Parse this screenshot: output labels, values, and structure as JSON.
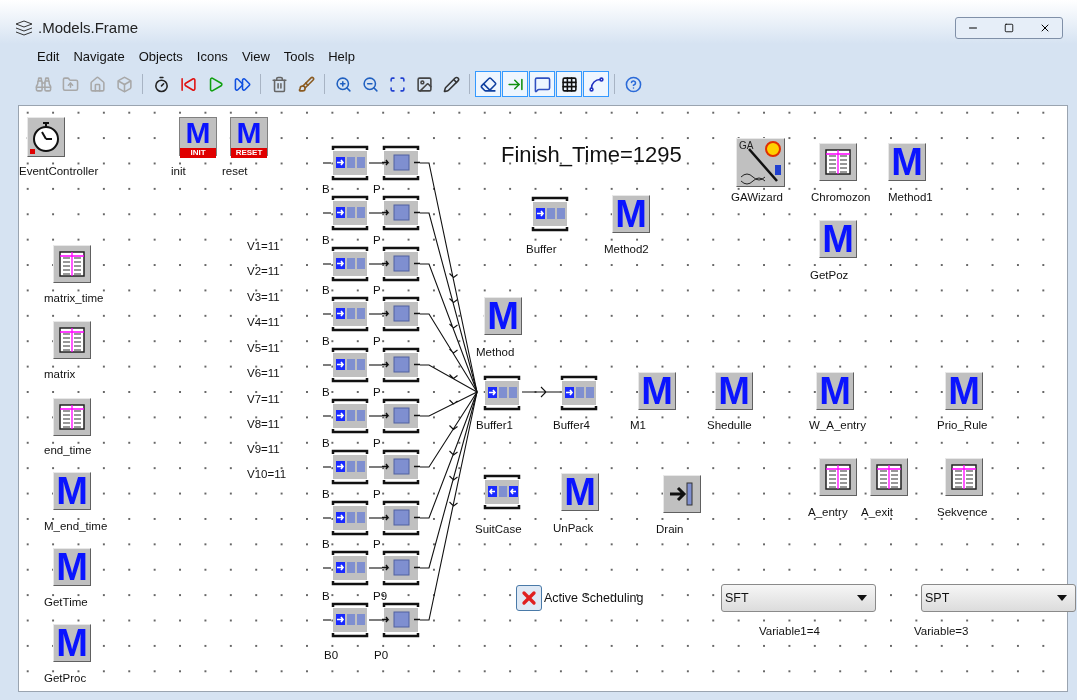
{
  "window": {
    "title": ".Models.Frame"
  },
  "menu": [
    "Edit",
    "Navigate",
    "Objects",
    "Icons",
    "View",
    "Tools",
    "Help"
  ],
  "toolbar": [
    {
      "kind": "binoculars",
      "disabled": true,
      "pressed": false
    },
    {
      "kind": "folder_up",
      "disabled": true,
      "pressed": false
    },
    {
      "kind": "home",
      "disabled": true,
      "pressed": false
    },
    {
      "kind": "three_d",
      "disabled": true,
      "pressed": false
    },
    {
      "kind": "separator"
    },
    {
      "kind": "stopwatch",
      "disabled": false,
      "pressed": false
    },
    {
      "kind": "reset",
      "disabled": false,
      "pressed": false
    },
    {
      "kind": "play",
      "disabled": false,
      "pressed": false
    },
    {
      "kind": "fast_forward",
      "disabled": false,
      "pressed": false
    },
    {
      "kind": "separator"
    },
    {
      "kind": "delete",
      "disabled": false,
      "pressed": false
    },
    {
      "kind": "broom",
      "disabled": false,
      "pressed": false
    },
    {
      "kind": "separator"
    },
    {
      "kind": "zoom_in",
      "disabled": false,
      "pressed": false
    },
    {
      "kind": "zoom_out",
      "disabled": false,
      "pressed": false
    },
    {
      "kind": "fit",
      "disabled": false,
      "pressed": false
    },
    {
      "kind": "picture",
      "disabled": false,
      "pressed": false
    },
    {
      "kind": "pencil",
      "disabled": false,
      "pressed": false
    },
    {
      "kind": "separator"
    },
    {
      "kind": "eraser",
      "disabled": false,
      "pressed": true
    },
    {
      "kind": "connector",
      "disabled": false,
      "pressed": true
    },
    {
      "kind": "comment",
      "disabled": false,
      "pressed": true
    },
    {
      "kind": "grid",
      "disabled": false,
      "pressed": true
    },
    {
      "kind": "curve",
      "disabled": false,
      "pressed": true
    },
    {
      "kind": "separator"
    },
    {
      "kind": "help",
      "disabled": false,
      "pressed": false
    }
  ],
  "canvas": {
    "finish_time": "Finish_Time=1295",
    "objects": [
      {
        "kind": "event_controller",
        "label": "EventController"
      },
      {
        "kind": "init",
        "label": "init",
        "icon_text": "M",
        "badge": "INIT"
      },
      {
        "kind": "reset",
        "label": "reset",
        "icon_text": "M",
        "badge": "RESET"
      },
      {
        "kind": "wizard",
        "label": "GAWizard",
        "icon_text": "GA"
      },
      {
        "kind": "table",
        "label": "Chromozon"
      },
      {
        "kind": "method",
        "label": "Method1",
        "icon_text": "M"
      },
      {
        "kind": "buffer",
        "label": "Buffer"
      },
      {
        "kind": "method",
        "label": "Method2",
        "icon_text": "M"
      },
      {
        "kind": "method",
        "label": "GetPoz",
        "icon_text": "M"
      },
      {
        "kind": "table",
        "label": "matrix_time"
      },
      {
        "kind": "method",
        "label": "Method",
        "icon_text": "M"
      },
      {
        "kind": "table",
        "label": "matrix"
      },
      {
        "kind": "buffer",
        "label": "Buffer1"
      },
      {
        "kind": "buffer",
        "label": "Buffer4"
      },
      {
        "kind": "method",
        "label": "M1",
        "icon_text": "M"
      },
      {
        "kind": "method",
        "label": "Shedulle",
        "icon_text": "M"
      },
      {
        "kind": "method",
        "label": "W_A_entry",
        "icon_text": "M"
      },
      {
        "kind": "method",
        "label": "Prio_Rule",
        "icon_text": "M"
      },
      {
        "kind": "table",
        "label": "end_time"
      },
      {
        "kind": "table",
        "label": "A_entry"
      },
      {
        "kind": "table",
        "label": "A_exit"
      },
      {
        "kind": "table",
        "label": "Sekvence"
      },
      {
        "kind": "method",
        "label": "M_end_time",
        "icon_text": "M"
      },
      {
        "kind": "container",
        "label": "SuitCase"
      },
      {
        "kind": "method",
        "label": "UnPack",
        "icon_text": "M"
      },
      {
        "kind": "drain",
        "label": "Drain"
      },
      {
        "kind": "method",
        "label": "GetTime",
        "icon_text": "M"
      },
      {
        "kind": "method",
        "label": "GetProc",
        "icon_text": "M"
      }
    ],
    "variables": [
      "V1=11",
      "V2=11",
      "V3=11",
      "V4=11",
      "V5=11",
      "V6=11",
      "V7=11",
      "V8=11",
      "V9=11",
      "V10=11"
    ],
    "line_labels": [
      {
        "buffer_label": "B",
        "processor_label": "P"
      },
      {
        "buffer_label": "B",
        "processor_label": "P"
      },
      {
        "buffer_label": "B",
        "processor_label": "P"
      },
      {
        "buffer_label": "B",
        "processor_label": "P"
      },
      {
        "buffer_label": "B",
        "processor_label": "P"
      },
      {
        "buffer_label": "B",
        "processor_label": "P"
      },
      {
        "buffer_label": "B",
        "processor_label": "P"
      },
      {
        "buffer_label": "B",
        "processor_label": "P"
      },
      {
        "buffer_label": "B",
        "processor_label": "P9"
      }
    ],
    "line_names": [
      "B0",
      "P0"
    ],
    "checkbox": {
      "label": "Active Scheduling",
      "checked": true
    },
    "dropdowns": [
      {
        "value": "SFT",
        "caption": "Variable1=4"
      },
      {
        "value": "SPT",
        "caption": "Variable=3"
      }
    ]
  }
}
